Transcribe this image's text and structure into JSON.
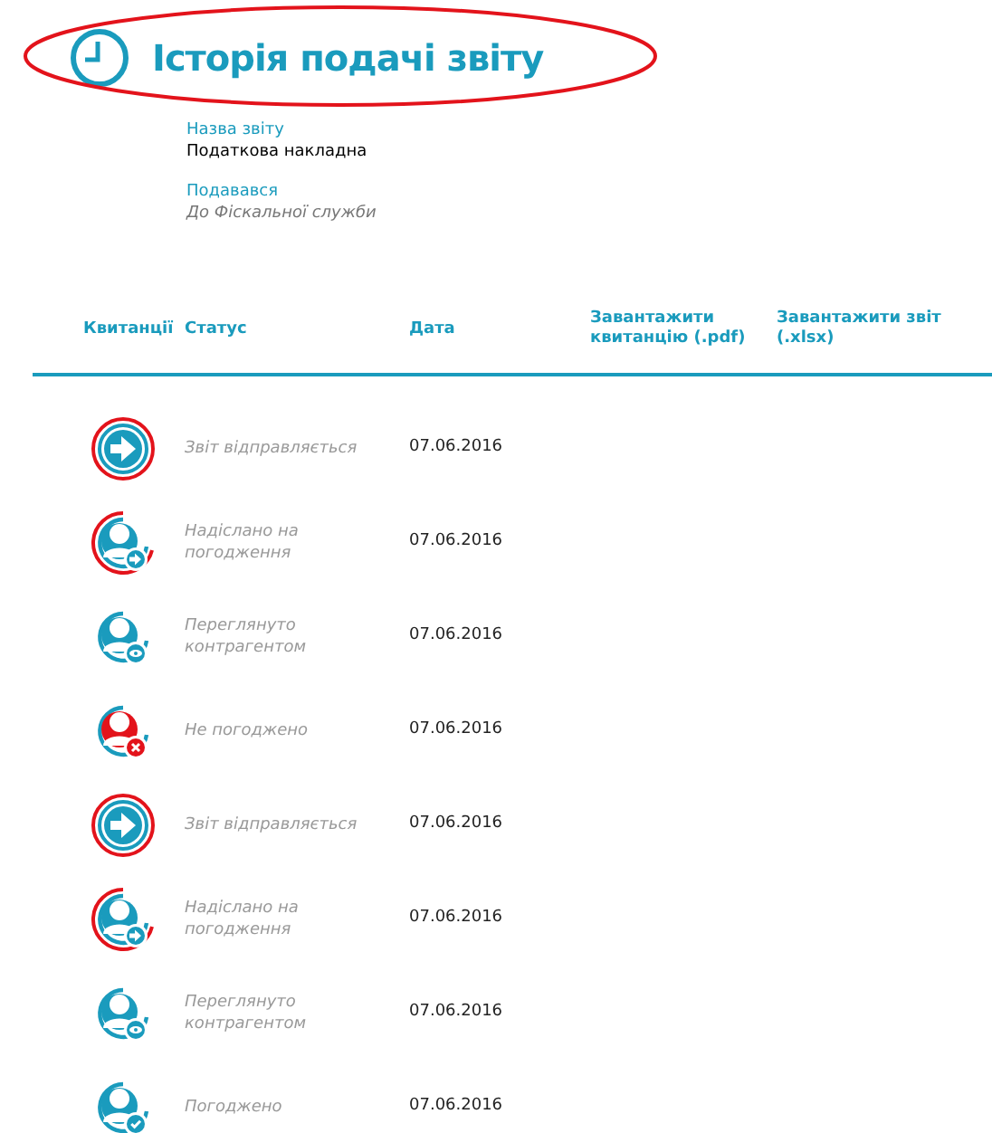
{
  "title": "Історія подачі звіту",
  "annotation": {
    "kind": "ellipse",
    "color": "#e3131b"
  },
  "info": [
    {
      "label": "Назва звіту",
      "value": "Податкова накладна",
      "italic": false
    },
    {
      "label": "Подавався",
      "value": "До Фіскальної служби",
      "italic": true
    }
  ],
  "table": {
    "columns": [
      "Квитанції",
      "Статус",
      "Дата",
      "Завантажити квитанцію (.pdf)",
      "Завантажити звіт (.xlsx)"
    ],
    "rows": [
      {
        "kind": "sending",
        "status": "Звіт відправляється",
        "date": "07.06.2016"
      },
      {
        "kind": "sent",
        "status": "Надіслано на погодження",
        "date": "07.06.2016"
      },
      {
        "kind": "viewed",
        "status": "Переглянуто контрагентом",
        "date": "07.06.2016"
      },
      {
        "kind": "rejected",
        "status": "Не погоджено",
        "date": "07.06.2016"
      },
      {
        "kind": "sending",
        "status": "Звіт відправляється",
        "date": "07.06.2016"
      },
      {
        "kind": "sent",
        "status": "Надіслано на погодження",
        "date": "07.06.2016"
      },
      {
        "kind": "viewed",
        "status": "Переглянуто контрагентом",
        "date": "07.06.2016"
      },
      {
        "kind": "approved",
        "status": "Погоджено",
        "date": "07.06.2016"
      }
    ]
  }
}
